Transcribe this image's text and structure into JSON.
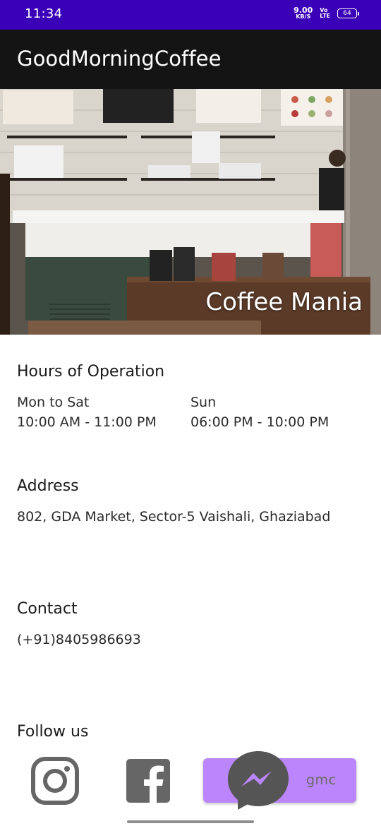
{
  "status_bar": {
    "time": "11:34",
    "net_speed_value": "9.00",
    "net_speed_unit": "KB/S",
    "volte_top": "Vo",
    "volte_bottom": "LTE",
    "battery": "64"
  },
  "app_bar": {
    "title": "GoodMorningCoffee"
  },
  "hero": {
    "title": "Coffee Mania"
  },
  "hours": {
    "heading": "Hours of Operation",
    "weekday_label": "Mon to Sat",
    "weekday_hours": "10:00 AM - 11:00 PM",
    "weekend_label": "Sun",
    "weekend_hours": "06:00 PM - 10:00 PM"
  },
  "address": {
    "heading": "Address",
    "text": "802, GDA Market, Sector-5 Vaishali, Ghaziabad"
  },
  "contact": {
    "heading": "Contact",
    "phone": "(+91)8405986693"
  },
  "follow": {
    "heading": "Follow us",
    "messenger_label": "gmc",
    "icons": [
      "instagram-icon",
      "facebook-icon",
      "messenger-icon"
    ]
  },
  "colors": {
    "status_bar": "#3a00b8",
    "app_bar": "#141414",
    "accent_pill": "#bb86fc",
    "icon_gray": "#666666"
  }
}
